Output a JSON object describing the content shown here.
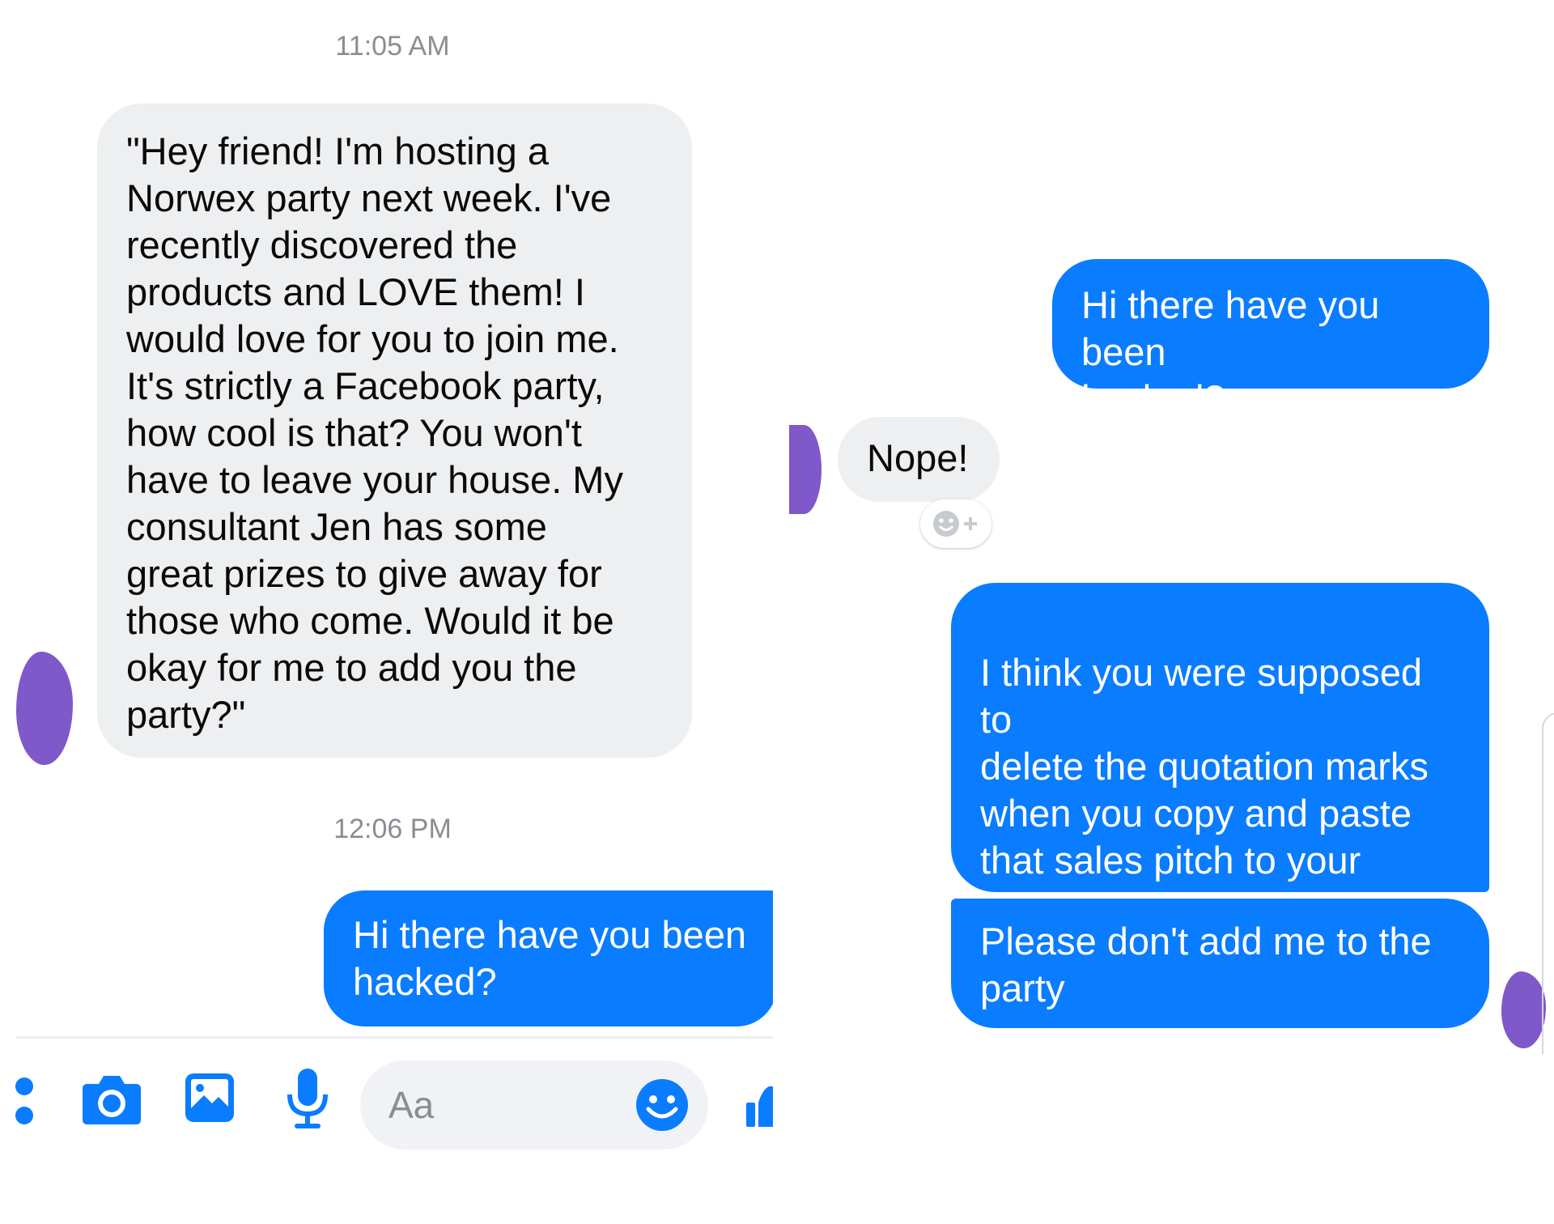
{
  "left_panel": {
    "timestamp_1": "11:05 AM",
    "incoming_message": "\"Hey friend! I'm hosting a\nNorwex party next week.  I've\nrecently discovered the\nproducts and LOVE them!  I\nwould love for you to join me.\nIt's strictly a Facebook party,\nhow cool is that?  You won't\nhave to leave your house.  My\nconsultant Jen has some\ngreat prizes to give away for\nthose who come.  Would it be\nokay for me to add you the\nparty?\"",
    "timestamp_2": "12:06 PM",
    "outgoing_message": "Hi there have you been\nhacked?",
    "composer": {
      "placeholder": "Aa",
      "icons": [
        "more-icon",
        "camera-icon",
        "image-icon",
        "microphone-icon",
        "emoji-icon",
        "like-icon"
      ]
    }
  },
  "right_panel": {
    "outgoing_1": "Hi there have you been\nhacked?",
    "incoming_1": "Nope!",
    "reaction_button": "add-reaction-icon",
    "outgoing_2": "I think you were supposed to\ndelete the quotation marks\nwhen you copy and paste\nthat sales pitch to your\nunsuspecting facebook\nfriends",
    "outgoing_2_emoji": "🙂",
    "outgoing_3": "Please don't add me to the\nparty"
  },
  "colors": {
    "outgoing_bubble": "#0a7cff",
    "incoming_bubble": "#eeeff1",
    "avatar": "#7f58c9",
    "timestamp": "#8a8d91"
  }
}
